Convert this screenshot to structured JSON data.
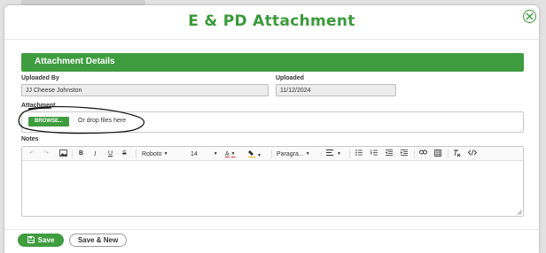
{
  "background": {
    "hint_text": ""
  },
  "modal": {
    "title": "E & PD Attachment",
    "close_icon": "close-circle-icon"
  },
  "section": {
    "title": "Attachment Details"
  },
  "fields": {
    "uploaded_by": {
      "label": "Uploaded By",
      "value": "JJ Cheese Johnston"
    },
    "uploaded": {
      "label": "Uploaded",
      "value": "11/12/2024"
    }
  },
  "attachment": {
    "label": "Attachment",
    "browse_label": "BROWSE...",
    "drop_text": "Or drop files here"
  },
  "notes": {
    "label": "Notes",
    "toolbar": {
      "font": "Roboto",
      "size": "14",
      "paragraph": "Paragra..."
    }
  },
  "footer": {
    "save_label": "Save",
    "save_new_label": "Save & New"
  },
  "colors": {
    "accent": "#3f9c3f",
    "title": "#3a9a3a"
  }
}
